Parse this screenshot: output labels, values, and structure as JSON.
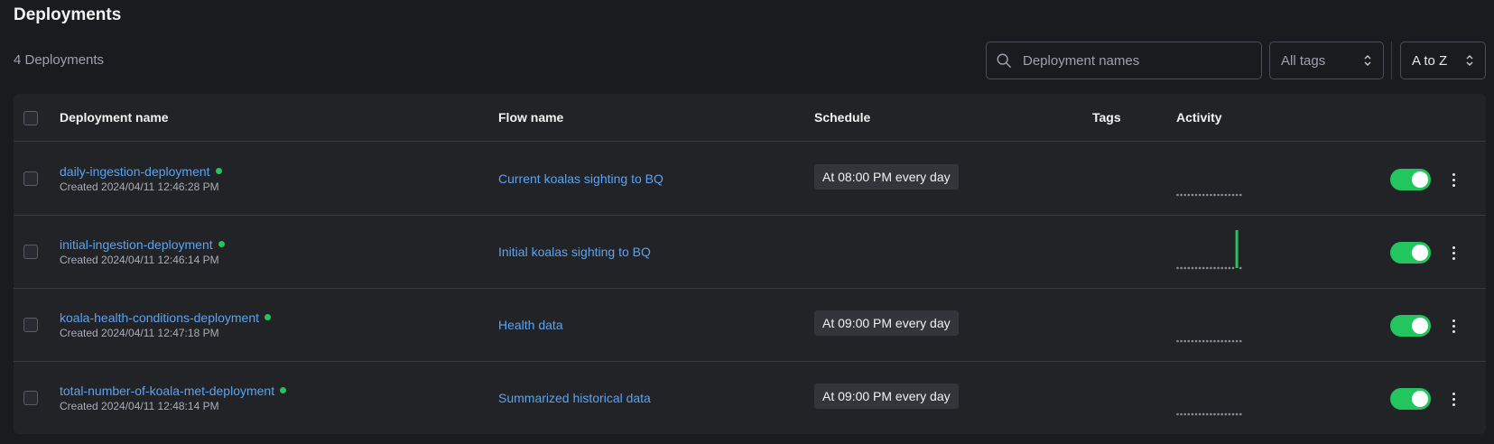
{
  "page": {
    "title": "Deployments",
    "count_label": "4 Deployments"
  },
  "search": {
    "placeholder": "Deployment names",
    "value": ""
  },
  "filters": {
    "tags_label": "All tags",
    "sort_label": "A to Z"
  },
  "table": {
    "columns": {
      "name": "Deployment name",
      "flow": "Flow name",
      "schedule": "Schedule",
      "tags": "Tags",
      "activity": "Activity"
    },
    "rows": [
      {
        "name": "daily-ingestion-deployment",
        "created": "Created 2024/04/11 12:46:28 PM",
        "flow": "Current koalas sighting to BQ",
        "schedule": "At 08:00 PM every day",
        "status_color": "#22c55e",
        "active": true,
        "activity": [
          0,
          0,
          0,
          0,
          0,
          0,
          0,
          0,
          0,
          0,
          0,
          0,
          0,
          0,
          0,
          0,
          0,
          0
        ]
      },
      {
        "name": "initial-ingestion-deployment",
        "created": "Created 2024/04/11 12:46:14 PM",
        "flow": "Initial koalas sighting to BQ",
        "schedule": "",
        "status_color": "#22c55e",
        "active": true,
        "activity": [
          0,
          0,
          0,
          0,
          0,
          0,
          0,
          0,
          0,
          0,
          0,
          0,
          0,
          0,
          0,
          0,
          1,
          0
        ]
      },
      {
        "name": "koala-health-conditions-deployment",
        "created": "Created 2024/04/11 12:47:18 PM",
        "flow": "Health data",
        "schedule": "At 09:00 PM every day",
        "status_color": "#22c55e",
        "active": true,
        "activity": [
          0,
          0,
          0,
          0,
          0,
          0,
          0,
          0,
          0,
          0,
          0,
          0,
          0,
          0,
          0,
          0,
          0,
          0
        ]
      },
      {
        "name": "total-number-of-koala-met-deployment",
        "created": "Created 2024/04/11 12:48:14 PM",
        "flow": "Summarized historical data",
        "schedule": "At 09:00 PM every day",
        "status_color": "#22c55e",
        "active": true,
        "activity": [
          0,
          0,
          0,
          0,
          0,
          0,
          0,
          0,
          0,
          0,
          0,
          0,
          0,
          0,
          0,
          0,
          0,
          0
        ]
      }
    ]
  },
  "colors": {
    "accent_link": "#5ba3f0",
    "success": "#22c55e",
    "background": "#1a1b1e",
    "panel": "#222327"
  },
  "icons": [
    "search-icon",
    "chevron-updown-icon",
    "kebab-menu-icon",
    "status-dot-icon"
  ]
}
